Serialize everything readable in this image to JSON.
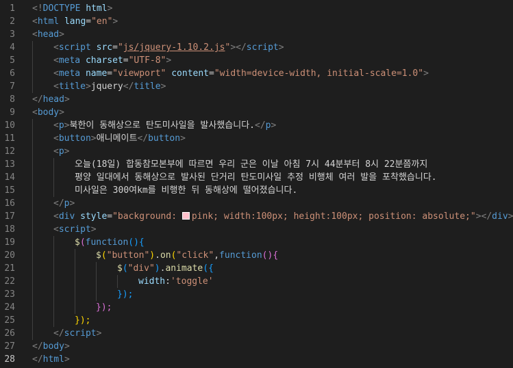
{
  "editor": {
    "active_line": 28,
    "lines": [
      {
        "n": "1",
        "indent": 0,
        "tokens": [
          {
            "t": "<!",
            "c": "#808080"
          },
          {
            "t": "DOCTYPE",
            "c": "#569cd6"
          },
          {
            "t": " ",
            "c": "#d4d4d4"
          },
          {
            "t": "html",
            "c": "#9cdcfe"
          },
          {
            "t": ">",
            "c": "#808080"
          }
        ]
      },
      {
        "n": "2",
        "indent": 0,
        "tokens": [
          {
            "t": "<",
            "c": "#808080"
          },
          {
            "t": "html",
            "c": "#569cd6"
          },
          {
            "t": " ",
            "c": "#d4d4d4"
          },
          {
            "t": "lang",
            "c": "#9cdcfe"
          },
          {
            "t": "=",
            "c": "#d4d4d4"
          },
          {
            "t": "\"en\"",
            "c": "#ce9178"
          },
          {
            "t": ">",
            "c": "#808080"
          }
        ]
      },
      {
        "n": "3",
        "indent": 0,
        "tokens": [
          {
            "t": "<",
            "c": "#808080"
          },
          {
            "t": "head",
            "c": "#569cd6"
          },
          {
            "t": ">",
            "c": "#808080"
          }
        ]
      },
      {
        "n": "4",
        "indent": 1,
        "tokens": [
          {
            "t": "<",
            "c": "#808080"
          },
          {
            "t": "script",
            "c": "#569cd6"
          },
          {
            "t": " ",
            "c": "#d4d4d4"
          },
          {
            "t": "src",
            "c": "#9cdcfe"
          },
          {
            "t": "=",
            "c": "#d4d4d4"
          },
          {
            "t": "\"",
            "c": "#ce9178"
          },
          {
            "t": "js/jquery-1.10.2.js",
            "c": "#ce9178",
            "u": true
          },
          {
            "t": "\"",
            "c": "#ce9178"
          },
          {
            "t": "></",
            "c": "#808080"
          },
          {
            "t": "script",
            "c": "#569cd6"
          },
          {
            "t": ">",
            "c": "#808080"
          }
        ]
      },
      {
        "n": "5",
        "indent": 1,
        "tokens": [
          {
            "t": "<",
            "c": "#808080"
          },
          {
            "t": "meta",
            "c": "#569cd6"
          },
          {
            "t": " ",
            "c": "#d4d4d4"
          },
          {
            "t": "charset",
            "c": "#9cdcfe"
          },
          {
            "t": "=",
            "c": "#d4d4d4"
          },
          {
            "t": "\"UTF-8\"",
            "c": "#ce9178"
          },
          {
            "t": ">",
            "c": "#808080"
          }
        ]
      },
      {
        "n": "6",
        "indent": 1,
        "tokens": [
          {
            "t": "<",
            "c": "#808080"
          },
          {
            "t": "meta",
            "c": "#569cd6"
          },
          {
            "t": " ",
            "c": "#d4d4d4"
          },
          {
            "t": "name",
            "c": "#9cdcfe"
          },
          {
            "t": "=",
            "c": "#d4d4d4"
          },
          {
            "t": "\"viewport\"",
            "c": "#ce9178"
          },
          {
            "t": " ",
            "c": "#d4d4d4"
          },
          {
            "t": "content",
            "c": "#9cdcfe"
          },
          {
            "t": "=",
            "c": "#d4d4d4"
          },
          {
            "t": "\"width=device-width, initial-scale=1.0\"",
            "c": "#ce9178"
          },
          {
            "t": ">",
            "c": "#808080"
          }
        ]
      },
      {
        "n": "7",
        "indent": 1,
        "tokens": [
          {
            "t": "<",
            "c": "#808080"
          },
          {
            "t": "title",
            "c": "#569cd6"
          },
          {
            "t": ">",
            "c": "#808080"
          },
          {
            "t": "jquery",
            "c": "#d4d4d4"
          },
          {
            "t": "</",
            "c": "#808080"
          },
          {
            "t": "title",
            "c": "#569cd6"
          },
          {
            "t": ">",
            "c": "#808080"
          }
        ]
      },
      {
        "n": "8",
        "indent": 0,
        "tokens": [
          {
            "t": "</",
            "c": "#808080"
          },
          {
            "t": "head",
            "c": "#569cd6"
          },
          {
            "t": ">",
            "c": "#808080"
          }
        ]
      },
      {
        "n": "9",
        "indent": 0,
        "tokens": [
          {
            "t": "<",
            "c": "#808080"
          },
          {
            "t": "body",
            "c": "#569cd6"
          },
          {
            "t": ">",
            "c": "#808080"
          }
        ]
      },
      {
        "n": "10",
        "indent": 1,
        "tokens": [
          {
            "t": "<",
            "c": "#808080"
          },
          {
            "t": "p",
            "c": "#569cd6"
          },
          {
            "t": ">",
            "c": "#808080"
          },
          {
            "t": "북한이 동해상으로 탄도미사일을 발사했습니다.",
            "c": "#d4d4d4"
          },
          {
            "t": "</",
            "c": "#808080"
          },
          {
            "t": "p",
            "c": "#569cd6"
          },
          {
            "t": ">",
            "c": "#808080"
          }
        ]
      },
      {
        "n": "11",
        "indent": 1,
        "tokens": [
          {
            "t": "<",
            "c": "#808080"
          },
          {
            "t": "button",
            "c": "#569cd6"
          },
          {
            "t": ">",
            "c": "#808080"
          },
          {
            "t": "애니메이트",
            "c": "#d4d4d4"
          },
          {
            "t": "</",
            "c": "#808080"
          },
          {
            "t": "button",
            "c": "#569cd6"
          },
          {
            "t": ">",
            "c": "#808080"
          }
        ]
      },
      {
        "n": "12",
        "indent": 1,
        "tokens": [
          {
            "t": "<",
            "c": "#808080"
          },
          {
            "t": "p",
            "c": "#569cd6"
          },
          {
            "t": ">",
            "c": "#808080"
          }
        ]
      },
      {
        "n": "13",
        "indent": 2,
        "tokens": [
          {
            "t": "오늘(18일) 합동참모본부에 따르면 우리 군은 이날 아침 7시 44분부터 8시 22분쯤까지",
            "c": "#d4d4d4"
          }
        ]
      },
      {
        "n": "14",
        "indent": 2,
        "tokens": [
          {
            "t": "평양 일대에서 동해상으로 발사된 단거리 탄도미사일 추정 비행체 여러 발을 포착했습니다.",
            "c": "#d4d4d4"
          }
        ]
      },
      {
        "n": "15",
        "indent": 2,
        "tokens": [
          {
            "t": "미사일은 300여km를 비행한 뒤 동해상에 떨어졌습니다.",
            "c": "#d4d4d4"
          }
        ]
      },
      {
        "n": "16",
        "indent": 1,
        "tokens": [
          {
            "t": "</",
            "c": "#808080"
          },
          {
            "t": "p",
            "c": "#569cd6"
          },
          {
            "t": ">",
            "c": "#808080"
          }
        ]
      },
      {
        "n": "17",
        "indent": 1,
        "tokens": [
          {
            "t": "<",
            "c": "#808080"
          },
          {
            "t": "div",
            "c": "#569cd6"
          },
          {
            "t": " ",
            "c": "#d4d4d4"
          },
          {
            "t": "style",
            "c": "#9cdcfe"
          },
          {
            "t": "=",
            "c": "#d4d4d4"
          },
          {
            "t": "\"background: ",
            "c": "#ce9178"
          },
          {
            "t": "",
            "swatch": true
          },
          {
            "t": "pink; width:100px; height:100px; position: absolute;\"",
            "c": "#ce9178"
          },
          {
            "t": "></",
            "c": "#808080"
          },
          {
            "t": "div",
            "c": "#569cd6"
          },
          {
            "t": ">",
            "c": "#808080"
          }
        ]
      },
      {
        "n": "18",
        "indent": 1,
        "tokens": [
          {
            "t": "<",
            "c": "#808080"
          },
          {
            "t": "script",
            "c": "#569cd6"
          },
          {
            "t": ">",
            "c": "#808080"
          }
        ]
      },
      {
        "n": "19",
        "indent": 2,
        "tokens": [
          {
            "t": "$",
            "c": "#dcdcaa"
          },
          {
            "t": "(",
            "c": "#da70d6"
          },
          {
            "t": "function",
            "c": "#569cd6"
          },
          {
            "t": "(){",
            "c": "#179fff"
          }
        ]
      },
      {
        "n": "20",
        "indent": 3,
        "tokens": [
          {
            "t": "$",
            "c": "#dcdcaa"
          },
          {
            "t": "(",
            "c": "#ffd700"
          },
          {
            "t": "\"button\"",
            "c": "#ce9178"
          },
          {
            "t": ")",
            "c": "#ffd700"
          },
          {
            "t": ".",
            "c": "#d4d4d4"
          },
          {
            "t": "on",
            "c": "#dcdcaa"
          },
          {
            "t": "(",
            "c": "#ffd700"
          },
          {
            "t": "\"click\"",
            "c": "#ce9178"
          },
          {
            "t": ",",
            "c": "#d4d4d4"
          },
          {
            "t": "function",
            "c": "#569cd6"
          },
          {
            "t": "(){",
            "c": "#da70d6"
          }
        ]
      },
      {
        "n": "21",
        "indent": 4,
        "tokens": [
          {
            "t": "$",
            "c": "#dcdcaa"
          },
          {
            "t": "(",
            "c": "#179fff"
          },
          {
            "t": "\"div\"",
            "c": "#ce9178"
          },
          {
            "t": ")",
            "c": "#179fff"
          },
          {
            "t": ".",
            "c": "#d4d4d4"
          },
          {
            "t": "animate",
            "c": "#dcdcaa"
          },
          {
            "t": "({",
            "c": "#179fff"
          }
        ]
      },
      {
        "n": "22",
        "indent": 5,
        "tokens": [
          {
            "t": "width",
            "c": "#9cdcfe"
          },
          {
            "t": ":",
            "c": "#d4d4d4"
          },
          {
            "t": "'toggle'",
            "c": "#ce9178"
          }
        ]
      },
      {
        "n": "23",
        "indent": 4,
        "tokens": [
          {
            "t": "});",
            "c": "#179fff"
          }
        ]
      },
      {
        "n": "24",
        "indent": 3,
        "tokens": [
          {
            "t": "});",
            "c": "#da70d6"
          }
        ]
      },
      {
        "n": "25",
        "indent": 2,
        "tokens": [
          {
            "t": "});",
            "c": "#ffd700"
          }
        ]
      },
      {
        "n": "26",
        "indent": 1,
        "tokens": [
          {
            "t": "</",
            "c": "#808080"
          },
          {
            "t": "script",
            "c": "#569cd6"
          },
          {
            "t": ">",
            "c": "#808080"
          }
        ]
      },
      {
        "n": "27",
        "indent": 0,
        "tokens": [
          {
            "t": "</",
            "c": "#808080"
          },
          {
            "t": "body",
            "c": "#569cd6"
          },
          {
            "t": ">",
            "c": "#808080"
          }
        ]
      },
      {
        "n": "28",
        "indent": 0,
        "tokens": [
          {
            "t": "</",
            "c": "#808080"
          },
          {
            "t": "html",
            "c": "#569cd6"
          },
          {
            "t": ">",
            "c": "#808080"
          }
        ]
      }
    ]
  }
}
